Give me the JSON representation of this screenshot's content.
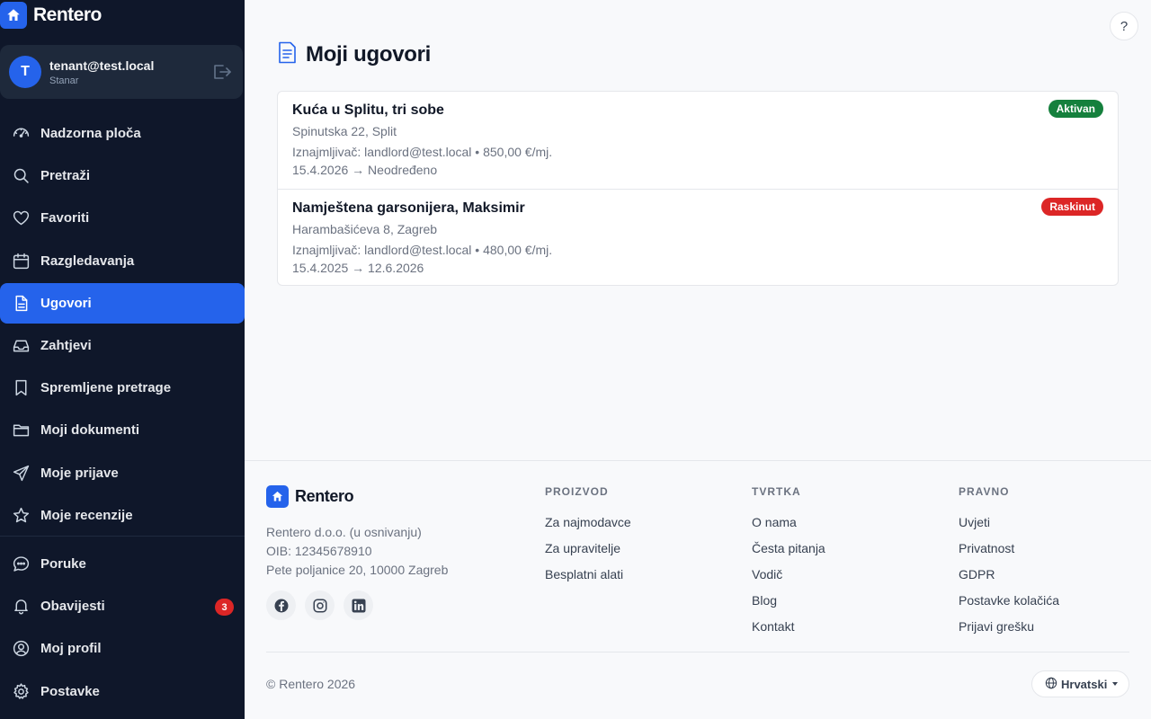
{
  "app": {
    "brand": "Rentero"
  },
  "user": {
    "initial": "T",
    "email": "tenant@test.local",
    "role": "Stanar"
  },
  "nav": [
    {
      "label": "Nadzorna ploča",
      "icon": "gauge-icon"
    },
    {
      "label": "Pretraži",
      "icon": "search-icon"
    },
    {
      "label": "Favoriti",
      "icon": "heart-icon"
    },
    {
      "label": "Razgledavanja",
      "icon": "calendar-icon"
    },
    {
      "label": "Ugovori",
      "icon": "document-icon",
      "active": true
    },
    {
      "label": "Zahtjevi",
      "icon": "inbox-icon"
    },
    {
      "label": "Spremljene pretrage",
      "icon": "bookmark-icon"
    },
    {
      "label": "Moji dokumenti",
      "icon": "folder-icon"
    },
    {
      "label": "Moje prijave",
      "icon": "send-icon"
    },
    {
      "label": "Moje recenzije",
      "icon": "star-icon"
    },
    {
      "label": "Poruke",
      "icon": "chat-icon"
    },
    {
      "label": "Obavijesti",
      "icon": "bell-icon",
      "badge": "3"
    },
    {
      "label": "Moj profil",
      "icon": "user-circle-icon"
    },
    {
      "label": "Postavke",
      "icon": "gear-icon"
    }
  ],
  "help": {
    "label": "?"
  },
  "page": {
    "title": "Moji ugovori"
  },
  "contracts": [
    {
      "title": "Kuća u Splitu, tri sobe",
      "address": "Spinutska 22, Split",
      "meta": "Iznajmljivač: landlord@test.local • 850,00 €/mj.",
      "dates": "15.4.2026 → Neodređeno",
      "status": "Aktivan",
      "status_color": "#15803d"
    },
    {
      "title": "Namještena garsonijera, Maksimir",
      "address": "Harambašićeva 8, Zagreb",
      "meta": "Iznajmljivač: landlord@test.local • 480,00 €/mj.",
      "dates": "15.4.2025 → 12.6.2026",
      "status": "Raskinut",
      "status_color": "#dc2626"
    }
  ],
  "footer": {
    "brand": "Rentero",
    "company_lines": [
      "Rentero d.o.o. (u osnivanju)",
      "OIB: 12345678910",
      "Pete poljanice 20, 10000 Zagreb"
    ],
    "socials": [
      "facebook-icon",
      "instagram-icon",
      "linkedin-icon"
    ],
    "columns": [
      {
        "title": "PROIZVOD",
        "links": [
          "Za najmodavce",
          "Za upravitelje",
          "Besplatni alati"
        ]
      },
      {
        "title": "TVRTKA",
        "links": [
          "O nama",
          "Česta pitanja",
          "Vodič",
          "Blog",
          "Kontakt"
        ]
      },
      {
        "title": "PRAVNO",
        "links": [
          "Uvjeti",
          "Privatnost",
          "GDPR",
          "Postavke kolačića",
          "Prijavi grešku"
        ]
      }
    ],
    "copyright": "© Rentero 2026",
    "language": "Hrvatski"
  },
  "colors": {
    "sidebar_bg": "#0f172a",
    "accent": "#2563eb",
    "active_status": "#15803d",
    "terminated_status": "#dc2626"
  }
}
